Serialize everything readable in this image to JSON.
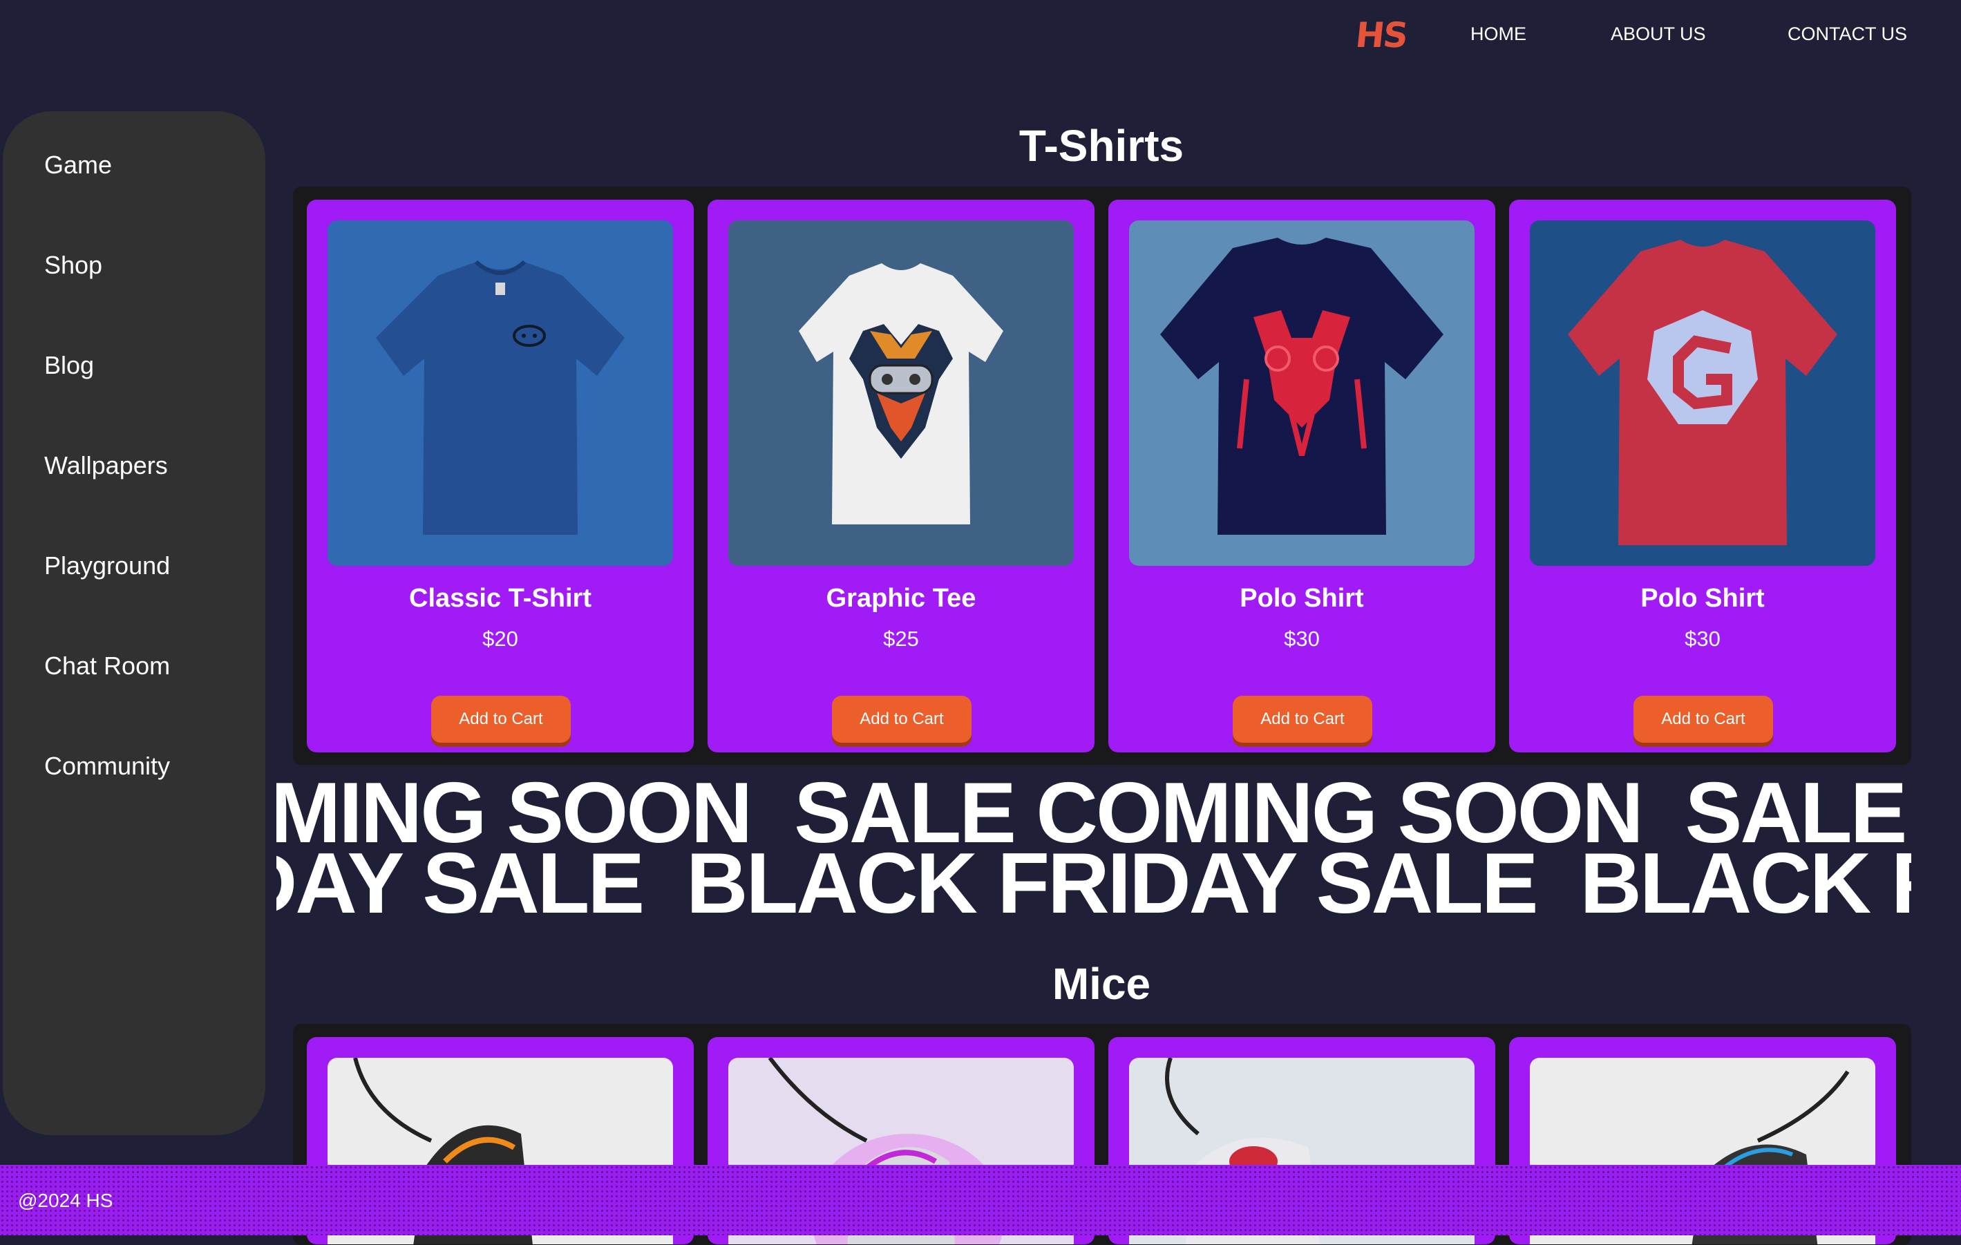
{
  "nav": {
    "logo": "HS",
    "links": [
      "HOME",
      "ABOUT US",
      "CONTACT US"
    ]
  },
  "sidebar": {
    "items": [
      "Game",
      "Shop",
      "Blog",
      "Wallpapers",
      "Playground",
      "Chat Room",
      "Community"
    ]
  },
  "tshirts": {
    "title": "T-Shirts",
    "products": [
      {
        "name": "Classic T-Shirt",
        "price": "$20",
        "button": "Add to Cart",
        "image": "blue-tshirt-controller-icon"
      },
      {
        "name": "Graphic Tee",
        "price": "$25",
        "button": "Add to Cart",
        "image": "white-tshirt-controller-graphic"
      },
      {
        "name": "Polo Shirt",
        "price": "$30",
        "button": "Add to Cart",
        "image": "navy-tshirt-red-graphic"
      },
      {
        "name": "Polo Shirt",
        "price": "$30",
        "button": "Add to Cart",
        "image": "red-tshirt-g-logo"
      }
    ]
  },
  "marquee": {
    "line1": "COMING SOON  SALE COMING SOON  SALE COMING SOON",
    "line2": "FRIDAY SALE  BLACK FRIDAY SALE  BLACK FRIDAY"
  },
  "mice": {
    "title": "Mice",
    "products": [
      {
        "image": "gaming-mouse-orange"
      },
      {
        "image": "gaming-mouse-pink"
      },
      {
        "image": "gaming-mouse-red"
      },
      {
        "image": "gaming-mouse-black"
      }
    ]
  },
  "footer": {
    "text": "@2024 HS"
  },
  "colors": {
    "background": "#1f1f38",
    "card": "#a01bf6",
    "button": "#ec5f2a",
    "logo": "#e5533a",
    "sidebar": "#313131"
  }
}
